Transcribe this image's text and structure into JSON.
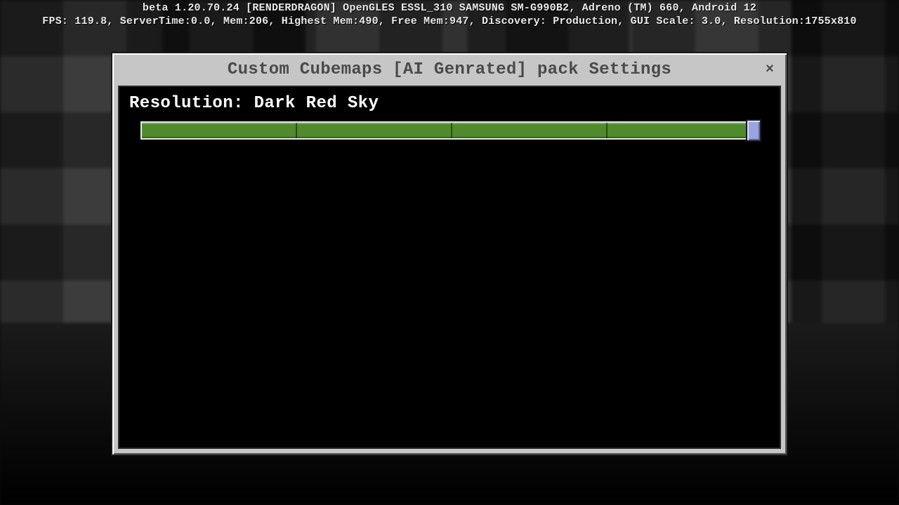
{
  "debug": {
    "line1": "beta 1.20.70.24 [RENDERDRAGON] OpenGLES ESSL_310 SAMSUNG SM-G990B2, Adreno (TM) 660, Android 12",
    "line2": "FPS: 119.8, ServerTime:0.0, Mem:206, Highest Mem:490, Free Mem:947, Discovery: Production, GUI Scale: 3.0, Resolution:1755x810"
  },
  "window": {
    "title": "Custom Cubemaps [AI Genrated] pack Settings",
    "close_label": "×"
  },
  "setting": {
    "label": "Resolution: Dark Red Sky",
    "slider": {
      "min": 0,
      "max": 4,
      "value": 4,
      "tick_positions_pct": [
        25,
        50,
        75
      ]
    }
  },
  "colors": {
    "panel": "#c6c6c6",
    "slider_fill": "#4f8a2d",
    "slider_thumb": "#9aa4e0"
  }
}
